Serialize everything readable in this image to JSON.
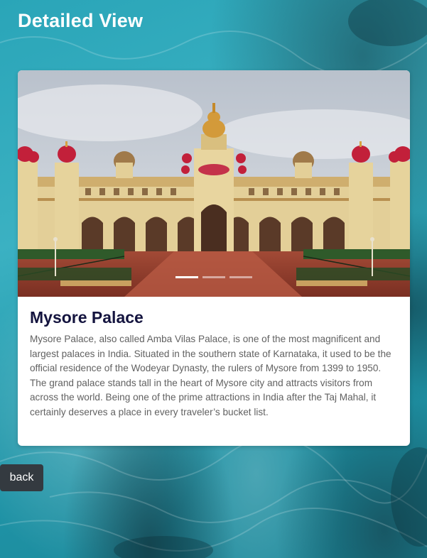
{
  "page": {
    "title": "Detailed View"
  },
  "place": {
    "name": "Mysore Palace",
    "description": "Mysore Palace, also called Amba Vilas Palace, is one of the most magnificent and largest palaces in India. Situated in the southern state of Karnataka, it used to be the official residence of the Wodeyar Dynasty, the rulers of Mysore from 1399 to 1950. The grand palace stands tall in the heart of Mysore city and attracts visitors from across the world. Being one of the prime attractions in India after the Taj Mahal, it certainly deserves a place in every traveler’s bucket list.",
    "image_alt": "Mysore Palace"
  },
  "carousel": {
    "slide_count": 3,
    "active_index": 0
  },
  "actions": {
    "back_label": "back"
  },
  "colors": {
    "title_text": "#ffffff",
    "place_title": "#14143f",
    "description_text": "#616161",
    "back_button_bg": "#343a40",
    "background_sea": "#2aa5b8"
  },
  "icons": {
    "background": "sea-water-background"
  }
}
